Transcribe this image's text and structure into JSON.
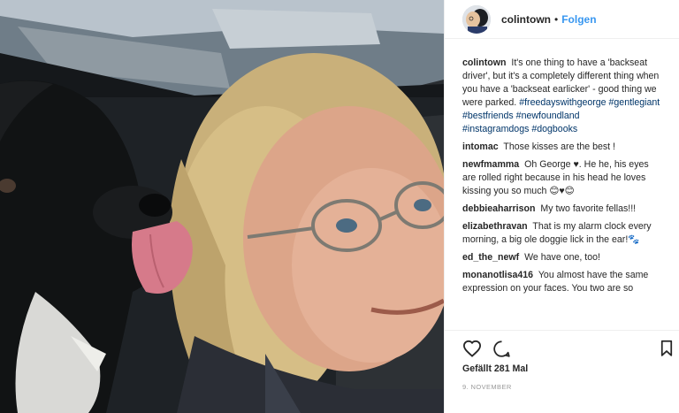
{
  "post": {
    "username": "colintown",
    "separator": "•",
    "follow_label": "Folgen",
    "caption": {
      "user": "colintown",
      "text": "It's one thing to have a 'backseat driver', but it's a completely different thing when you have a 'backseat earlicker' - good thing we were parked.",
      "hashtags": [
        "#freedayswithgeorge",
        "#gentlegiant",
        "#bestfriends",
        "#newfoundland",
        "#instagramdogs",
        "#dogbooks"
      ]
    },
    "comments": [
      {
        "user": "intomac",
        "text": "Those kisses are the best !"
      },
      {
        "user": "newfmamma",
        "text": "Oh George ♥. He he, his eyes are rolled right because in his head he loves kissing you so much 😊♥😊"
      },
      {
        "user": "debbieaharrison",
        "text": "My two favorite fellas!!!"
      },
      {
        "user": "elizabethravan",
        "text": "That is my alarm clock every morning, a big ole doggie lick in the ear!🐾"
      },
      {
        "user": "ed_the_newf",
        "text": "We have one, too!"
      },
      {
        "user": "monanotlisa416",
        "text": "You almost have the same expression on your faces. You two are so"
      }
    ],
    "likes_label": "Gefällt 281 Mal",
    "date": "9. NOVEMBER"
  },
  "icons": {
    "like": "heart-icon",
    "comment": "comment-icon",
    "save": "bookmark-icon"
  },
  "colors": {
    "link": "#3897f0",
    "hashtag": "#003569",
    "text": "#262626",
    "muted": "#999999"
  }
}
